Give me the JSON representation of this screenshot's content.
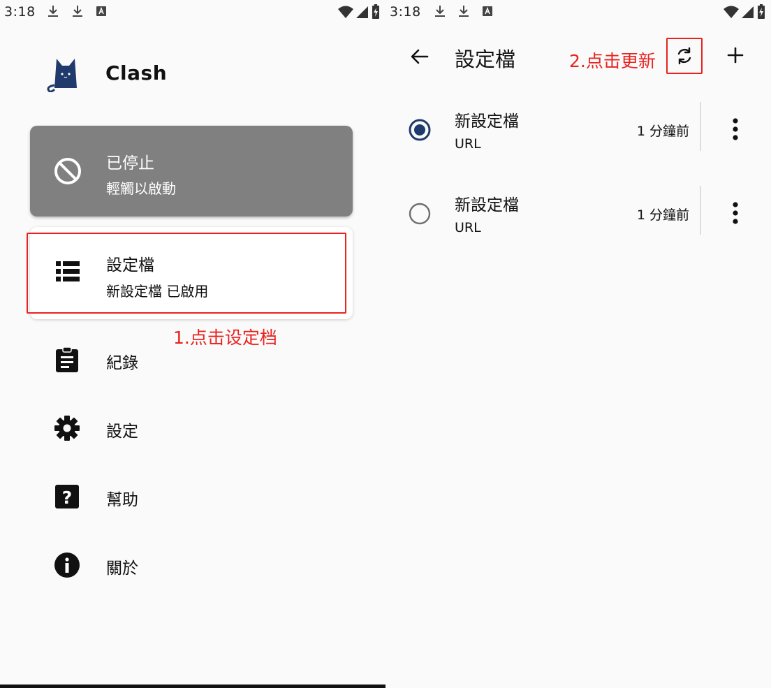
{
  "left_screen": {
    "status_bar": {
      "time": "3:18"
    },
    "app": {
      "title": "Clash"
    },
    "status_card": {
      "title": "已停止",
      "subtitle": "輕觸以啟動"
    },
    "profile_card": {
      "title": "設定檔",
      "subtitle": "新設定檔 已啟用"
    },
    "annotation": "1.点击设定档",
    "menu": [
      {
        "label": "紀錄",
        "icon": "clipboard-icon"
      },
      {
        "label": "設定",
        "icon": "gear-icon"
      },
      {
        "label": "幫助",
        "icon": "help-icon"
      },
      {
        "label": "關於",
        "icon": "info-icon"
      }
    ]
  },
  "right_screen": {
    "status_bar": {
      "time": "3:18"
    },
    "toolbar": {
      "title": "設定檔"
    },
    "annotation": "2.点击更新",
    "profiles": [
      {
        "name": "新設定檔",
        "type": "URL",
        "updated": "1 分鐘前",
        "selected": true
      },
      {
        "name": "新設定檔",
        "type": "URL",
        "updated": "1 分鐘前",
        "selected": false
      }
    ]
  },
  "colors": {
    "annotation_red": "#e8231f",
    "stopped_card": "#808080",
    "radio_selected": "#1e3a6e",
    "logo_blue": "#1f3a6b"
  }
}
